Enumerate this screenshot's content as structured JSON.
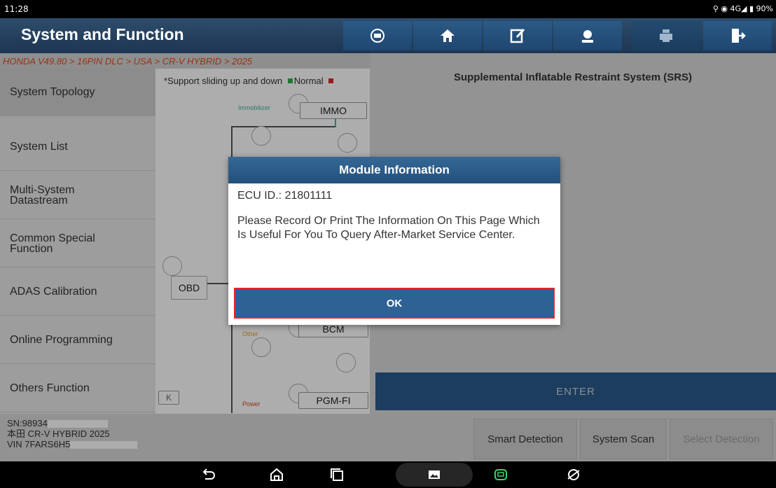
{
  "status_bar": {
    "time": "11:28",
    "indicators": "⚲ ◉ 4G◢ ▮ 90%"
  },
  "header": {
    "title": "System and Function",
    "icons": [
      "vci-icon",
      "home-icon",
      "report-icon",
      "support-icon",
      "print-icon",
      "exit-icon"
    ]
  },
  "breadcrumb": "HONDA V49.80 > 16PIN DLC > USA > CR-V HYBRID > 2025",
  "sidebar": {
    "items": [
      {
        "label": "System Topology"
      },
      {
        "label": "System List"
      },
      {
        "label": "Multi-System Datastream"
      },
      {
        "label": "Common Special Function"
      },
      {
        "label": "ADAS Calibration"
      },
      {
        "label": "Online Programming"
      },
      {
        "label": "Others Function"
      }
    ]
  },
  "topology": {
    "hint": "*Support sliding up and down",
    "legend_normal": "Normal",
    "collapse_label": "K",
    "nodes": {
      "immo_group": "Immobilizer",
      "immo": "IMMO",
      "obd": "OBD",
      "bcm_group": "Other",
      "bcm": "BCM",
      "pgm_group": "Power",
      "pgm": "PGM-FI"
    },
    "colors": {
      "normal": "#2fb14a",
      "fault": "#e5242c",
      "immobilizer": "#3bb3a2",
      "other": "#e0a030",
      "power": "#e04a22"
    }
  },
  "right_panel": {
    "title": "Supplemental Inflatable Restraint System (SRS)",
    "enter_label": "ENTER"
  },
  "footer": {
    "sn": "SN:98934",
    "vehicle": "本田 CR-V HYBRID 2025",
    "vin": "VIN 7FARS6H5",
    "buttons": {
      "smart_detection": "Smart Detection",
      "system_scan": "System Scan",
      "select_detection": "Select Detection"
    }
  },
  "dialog": {
    "title": "Module Information",
    "ecu_id": "ECU ID.: 21801111",
    "message": "Please Record Or Print The Information On This Page Which Is Useful For You To Query After-Market Service Center.",
    "ok_label": "OK"
  },
  "nav_bar": {
    "icons": [
      "back-icon",
      "home-nav-icon",
      "recents-icon",
      "gallery-icon",
      "vci-app-icon",
      "browser-icon"
    ]
  }
}
